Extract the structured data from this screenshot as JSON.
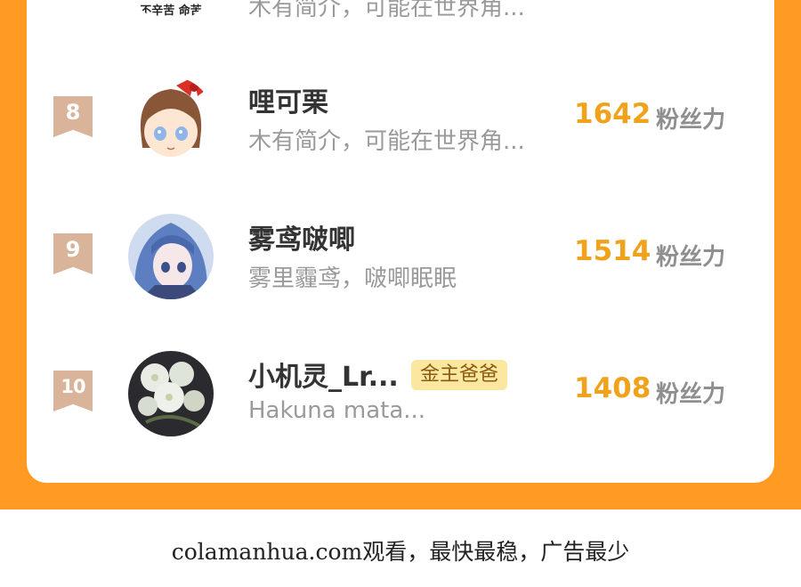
{
  "ranking": {
    "partial_top": {
      "bio": "木有简介，可能在世界角...",
      "avatar_caption": "不辛苦 命苦"
    },
    "entries": [
      {
        "rank": "8",
        "name": "哩可栗",
        "bio": "木有简介，可能在世界角...",
        "fans": "1642",
        "fans_label": "粉丝力",
        "avatar": "anime-girl-red-bow-avatar"
      },
      {
        "rank": "9",
        "name": "雾鸢啵唧",
        "bio": "雾里霾鸢，啵唧眠眠",
        "fans": "1514",
        "fans_label": "粉丝力",
        "avatar": "anime-girl-blue-hair-avatar"
      },
      {
        "rank": "10",
        "name": "小机灵_Lr...",
        "badge": "金主爸爸",
        "bio": "Hakuna mata...",
        "fans": "1408",
        "fans_label": "粉丝力",
        "avatar": "white-flowers-avatar"
      }
    ]
  },
  "footer": {
    "text": "colamanhua.com观看，最快最稳，广告最少"
  },
  "colors": {
    "background_orange": "#ff9a22",
    "rank_badge": "#d9b49a",
    "fans_number": "#f0a21c",
    "supporter_badge": "#fbe7a0"
  }
}
